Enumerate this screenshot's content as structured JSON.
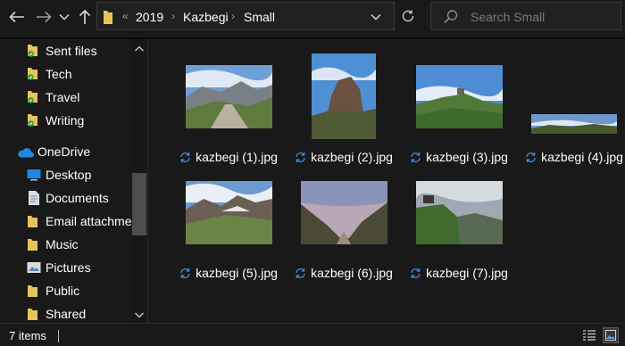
{
  "nav": {
    "back": "left-arrow-icon",
    "forward": "right-arrow-icon",
    "recent": "chevron-down-icon",
    "up": "up-arrow-icon"
  },
  "address": {
    "overflow": "«",
    "crumbs": [
      "2019",
      "Kazbegi",
      "Small"
    ]
  },
  "search": {
    "placeholder": "Search Small"
  },
  "sidebar": {
    "items": [
      {
        "label": "Sent files",
        "icon": "folder-synced-icon"
      },
      {
        "label": "Tech",
        "icon": "folder-synced-icon"
      },
      {
        "label": "Travel",
        "icon": "folder-synced-icon"
      },
      {
        "label": "Writing",
        "icon": "folder-synced-icon"
      },
      {
        "label": "OneDrive",
        "icon": "cloud-icon"
      },
      {
        "label": "Desktop",
        "icon": "desktop-icon"
      },
      {
        "label": "Documents",
        "icon": "document-icon"
      },
      {
        "label": "Email attachments",
        "icon": "folder-icon"
      },
      {
        "label": "Music",
        "icon": "folder-icon"
      },
      {
        "label": "Pictures",
        "icon": "pictures-icon"
      },
      {
        "label": "Public",
        "icon": "folder-icon"
      },
      {
        "label": "Shared",
        "icon": "folder-icon"
      }
    ]
  },
  "files": [
    {
      "name": "kazbegi (1).jpg",
      "scene": "valley-path"
    },
    {
      "name": "kazbegi (2).jpg",
      "scene": "rock-peak"
    },
    {
      "name": "kazbegi (3).jpg",
      "scene": "hill-church"
    },
    {
      "name": "kazbegi (4).jpg",
      "scene": "panorama"
    },
    {
      "name": "kazbegi (5).jpg",
      "scene": "mountains-clouds"
    },
    {
      "name": "kazbegi (6).jpg",
      "scene": "gorge-dusk"
    },
    {
      "name": "kazbegi (7).jpg",
      "scene": "cliff-church"
    }
  ],
  "status": {
    "count": "7 items"
  },
  "colors": {
    "sync": "#3d8fe0",
    "folder": "#e8c25a",
    "synced_badge": "#2ea043",
    "accent": "#1e88e5"
  }
}
